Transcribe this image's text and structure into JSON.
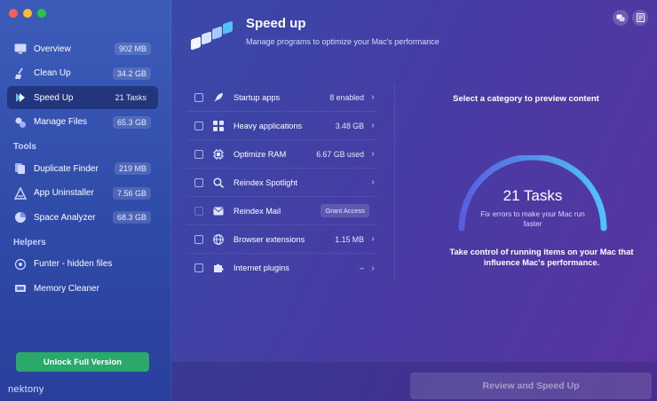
{
  "sidebar": {
    "main_items": [
      {
        "label": "Overview",
        "badge": "902 MB",
        "icon": "overview-icon"
      },
      {
        "label": "Clean Up",
        "badge": "34.2 GB",
        "icon": "broom-icon"
      },
      {
        "label": "Speed Up",
        "badge": "21 Tasks",
        "icon": "speed-arrows-icon"
      },
      {
        "label": "Manage Files",
        "badge": "65.3 GB",
        "icon": "files-icon"
      }
    ],
    "tools_header": "Tools",
    "tools": [
      {
        "label": "Duplicate Finder",
        "badge": "219 MB",
        "icon": "duplicate-icon"
      },
      {
        "label": "App Uninstaller",
        "badge": "7.56 GB",
        "icon": "uninstaller-icon"
      },
      {
        "label": "Space Analyzer",
        "badge": "68.3 GB",
        "icon": "pie-chart-icon"
      }
    ],
    "helpers_header": "Helpers",
    "helpers": [
      {
        "label": "Funter - hidden files",
        "icon": "eye-icon"
      },
      {
        "label": "Memory Cleaner",
        "icon": "memory-chip-icon"
      }
    ],
    "unlock_label": "Unlock Full Version",
    "brand": "nektony"
  },
  "header": {
    "title": "Speed up",
    "subtitle": "Manage programs to optimize your Mac's performance"
  },
  "list": [
    {
      "label": "Startup apps",
      "value": "8 enabled",
      "icon": "rocket-icon"
    },
    {
      "label": "Heavy applications",
      "value": "3.48 GB",
      "icon": "apps-grid-icon"
    },
    {
      "label": "Optimize RAM",
      "value": "6.67 GB used",
      "icon": "ram-chip-icon"
    },
    {
      "label": "Reindex Spotlight",
      "value": "",
      "icon": "magnifier-icon"
    },
    {
      "label": "Reindex Mail",
      "value": "Grant Access",
      "icon": "mail-icon"
    },
    {
      "label": "Browser extensions",
      "value": "1.15 MB",
      "icon": "globe-icon"
    },
    {
      "label": "Internet plugins",
      "value": "–",
      "icon": "puzzle-icon"
    }
  ],
  "preview": {
    "heading": "Select a category to preview content",
    "gauge_value": "21 Tasks",
    "gauge_desc": "Fix errors to make your Mac run faster",
    "description": "Take control of running items on your Mac that influence Mac's performance."
  },
  "footer": {
    "review_label": "Review and Speed Up"
  },
  "colors": {
    "accent_green": "#2aa96b",
    "gauge_start": "#5a5de0",
    "gauge_end": "#4fc3f7"
  }
}
